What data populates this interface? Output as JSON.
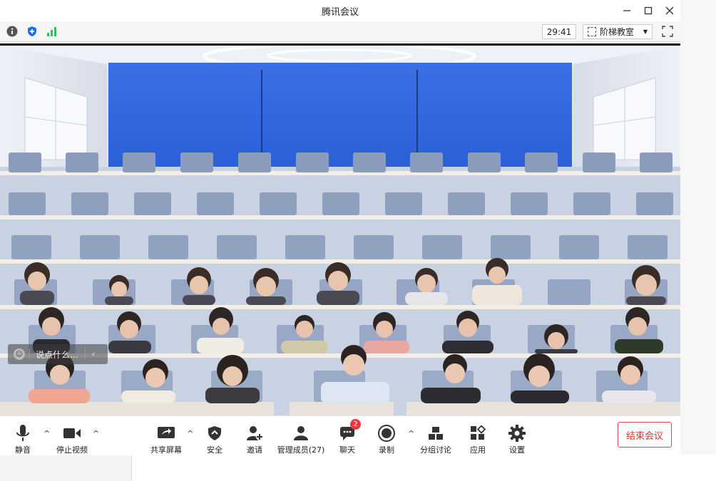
{
  "window": {
    "title": "腾讯会议",
    "controls": [
      "minimize-icon",
      "maximize-icon",
      "close-icon"
    ]
  },
  "statusbar": {
    "icons": [
      "info-icon",
      "shield-icon",
      "signal-icon"
    ],
    "timer": "29:41",
    "layout_label": "阶梯教室"
  },
  "chat": {
    "placeholder": "说点什么..."
  },
  "toolbar": {
    "mute": "静音",
    "stop_video": "停止视频",
    "share_screen": "共享屏幕",
    "security": "安全",
    "invite": "邀请",
    "manage_members": "管理成员(27)",
    "chat": "聊天",
    "chat_badge": "2",
    "record": "录制",
    "breakout": "分组讨论",
    "apps": "应用",
    "settings": "设置",
    "end_meeting": "结束会议"
  },
  "colors": {
    "wall_blue": "#2f64e0",
    "end_red": "#e03030",
    "badge_red": "#e83a3a"
  }
}
